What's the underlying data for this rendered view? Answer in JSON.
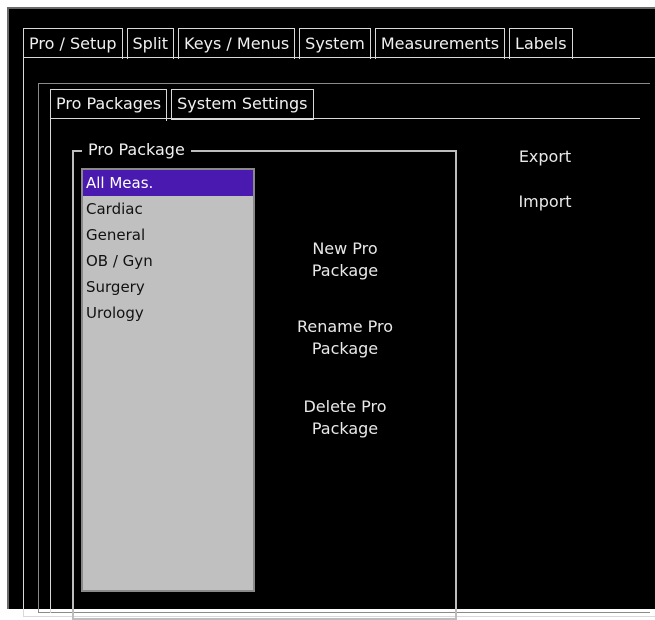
{
  "top_tabs": [
    "Pro / Setup",
    "Split",
    "Keys / Menus",
    "System",
    "Measurements",
    "Labels"
  ],
  "sub_tabs": [
    "Pro Packages",
    "System Settings"
  ],
  "group": {
    "label": "Pro Package"
  },
  "list": {
    "items": [
      "All Meas.",
      "Cardiac",
      "General",
      "OB / Gyn",
      "Surgery",
      "Urology"
    ],
    "selected": "All Meas."
  },
  "buttons": {
    "new": [
      "New Pro",
      "Package"
    ],
    "rename": [
      "Rename Pro",
      "Package"
    ],
    "delete": [
      "Delete Pro",
      "Package"
    ],
    "export": "Export",
    "import": "Import"
  },
  "colors": {
    "selection": "#4a1ab0",
    "background": "#000000",
    "list_bg": "#c0c0c0"
  }
}
